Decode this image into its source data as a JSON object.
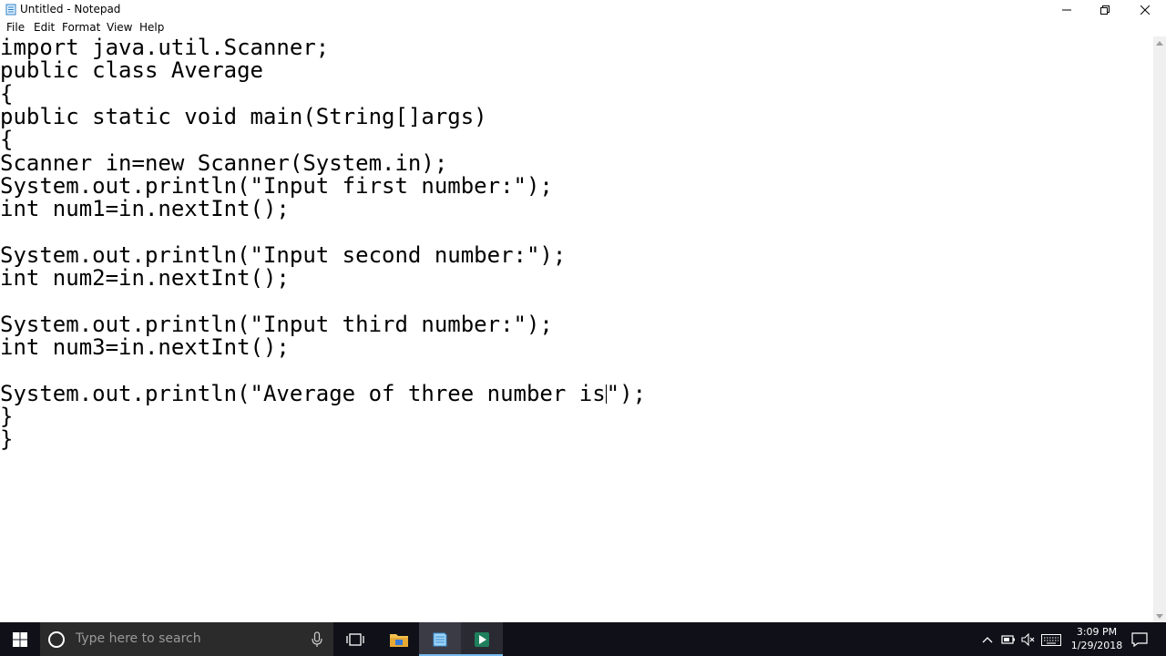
{
  "window": {
    "title": "Untitled - Notepad"
  },
  "menu": [
    {
      "name": "menu-file",
      "label": "File"
    },
    {
      "name": "menu-edit",
      "label": "Edit"
    },
    {
      "name": "menu-format",
      "label": "Format"
    },
    {
      "name": "menu-view",
      "label": "View"
    },
    {
      "name": "menu-help",
      "label": "Help"
    }
  ],
  "editor": {
    "lines": [
      "import java.util.Scanner;",
      "public class Average",
      "{",
      "public static void main(String[]args)",
      "{",
      "Scanner in=new Scanner(System.in);",
      "System.out.println(\"Input first number:\");",
      "int num1=in.nextInt();",
      "",
      "System.out.println(\"Input second number:\");",
      "int num2=in.nextInt();",
      "",
      "System.out.println(\"Input third number:\");",
      "int num3=in.nextInt();",
      "",
      "System.out.println(\"Average of three number is\");",
      "}",
      "}"
    ],
    "caret_line": 15,
    "caret_after": "System.out.println(\"Average of three number is",
    "caret_rest": "\");"
  },
  "taskbar": {
    "search_placeholder": "Type here to search",
    "time": "3:09 PM",
    "date": "1/29/2018"
  },
  "icons": {
    "start": "windows-logo-icon",
    "search": "cortana-circle-icon",
    "mic": "microphone-icon",
    "task_view": "task-view-icon",
    "explorer": "file-explorer-icon",
    "notepad": "notepad-icon",
    "camtasia": "camtasia-icon"
  },
  "colors": {
    "taskbar_bg": "#0f1018",
    "search_bg": "#2b2b2b",
    "active_indicator": "#76b9ed"
  }
}
